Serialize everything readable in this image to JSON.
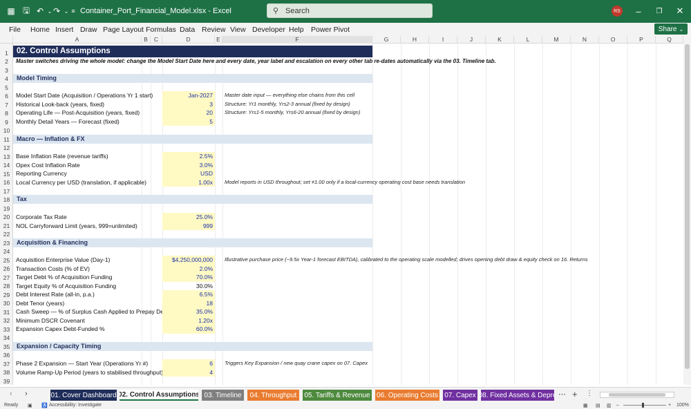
{
  "titlebar": {
    "filename": "Container_Port_Financial_Model.xlsx  -  Excel",
    "search_placeholder": "Search",
    "avatar": "RS"
  },
  "menu": [
    "File",
    "Home",
    "Insert",
    "Draw",
    "Page Layout",
    "Formulas",
    "Data",
    "Review",
    "View",
    "Developer",
    "Help",
    "Power Pivot"
  ],
  "share_label": "Share",
  "columns": [
    "A",
    "B",
    "C",
    "D",
    "E",
    "F",
    "G",
    "H",
    "I",
    "J",
    "K",
    "L",
    "M",
    "N",
    "O",
    "P",
    "Q"
  ],
  "rows": [
    "1",
    "2",
    "3",
    "4",
    "5",
    "6",
    "7",
    "8",
    "9",
    "10",
    "11",
    "12",
    "13",
    "14",
    "15",
    "16",
    "17",
    "18",
    "19",
    "20",
    "21",
    "22",
    "23",
    "24",
    "25",
    "26",
    "27",
    "28",
    "29",
    "30",
    "31",
    "32",
    "33",
    "34",
    "35",
    "36",
    "37",
    "38",
    "39"
  ],
  "sheet": {
    "title": "02. Control Assumptions",
    "subtitle": "Master switches driving the whole model: change the Model Start Date here and every date, year label and escalation on every other tab re-dates automatically via the 03. Timeline tab.",
    "sections": {
      "timing": "Model Timing",
      "macro": "Macro — Inflation & FX",
      "tax": "Tax",
      "acq": "Acquisition & Financing",
      "exp": "Expansion / Capacity Timing"
    },
    "items": {
      "r6": {
        "label": "Model Start Date (Acquisition / Operations Yr 1 start)",
        "value": "Jan-2027",
        "note": "Master date input — everything else chains from this cell"
      },
      "r7": {
        "label": "Historical Look-back (years, fixed)",
        "value": "3",
        "note": "Structure: Yr1 monthly, Yrs2-3 annual (fixed by design)"
      },
      "r8": {
        "label": "Operating Life — Post-Acquisition (years, fixed)",
        "value": "20",
        "note": "Structure: Yrs1-5 monthly, Yrs6-20 annual (fixed by design)"
      },
      "r9": {
        "label": "Monthly Detail Years — Forecast (fixed)",
        "value": "5"
      },
      "r13": {
        "label": "Base Inflation Rate (revenue tariffs)",
        "value": "2.5%"
      },
      "r14": {
        "label": "Opex Cost Inflation Rate",
        "value": "3.0%"
      },
      "r15": {
        "label": "Reporting Currency",
        "value": "USD"
      },
      "r16": {
        "label": "Local Currency per USD (translation, if applicable)",
        "value": "1.00x",
        "note": "Model reports in USD throughout; set ≠1.00 only if a local-currency operating cost base needs translation"
      },
      "r20": {
        "label": "Corporate Tax Rate",
        "value": "25.0%"
      },
      "r21": {
        "label": "NOL Carryforward Limit (years, 999=unlimited)",
        "value": "999"
      },
      "r25": {
        "label": "Acquisition Enterprise Value (Day-1)",
        "value": "$4,250,000,000",
        "note": "Illustrative purchase price (~9.5x Year-1 forecast EBITDA), calibrated to the operating scale modelled; drives opening debt draw & equity check on 16. Returns"
      },
      "r26": {
        "label": "Transaction Costs (% of EV)",
        "value": "2.0%"
      },
      "r27": {
        "label": "Target Debt % of Acquisition Funding",
        "value": "70.0%"
      },
      "r28": {
        "label": "Target Equity % of Acquisition Funding",
        "value": "30.0%"
      },
      "r29": {
        "label": "Debt Interest Rate (all-in, p.a.)",
        "value": "6.5%"
      },
      "r30": {
        "label": "Debt Tenor (years)",
        "value": "18"
      },
      "r31": {
        "label": "Cash Sweep — % of Surplus Cash Applied to Prepay Debt",
        "value": "35.0%"
      },
      "r32": {
        "label": "Minimum DSCR Covenant",
        "value": "1.20x"
      },
      "r33": {
        "label": "Expansion Capex Debt-Funded %",
        "value": "60.0%"
      },
      "r37": {
        "label": "Phase 2 Expansion — Start Year (Operations Yr #)",
        "value": "6",
        "note": "Triggers Key Expansion / new quay crane capex on 07. Capex"
      },
      "r38": {
        "label": "Volume Ramp-Up Period (years to stabilised throughput)",
        "value": "4"
      }
    }
  },
  "tabs": [
    {
      "label": "01. Cover Dashboard",
      "color": "#1f2d5a"
    },
    {
      "label": "02. Control Assumptions",
      "color": "#ffffff"
    },
    {
      "label": "03. Timeline",
      "color": "#7f7f7f"
    },
    {
      "label": "04. Throughput",
      "color": "#e97c30"
    },
    {
      "label": "05. Tariffs & Revenue",
      "color": "#4e8a3e"
    },
    {
      "label": "06. Operating Costs",
      "color": "#e97c30"
    },
    {
      "label": "07. Capex",
      "color": "#7030a0"
    },
    {
      "label": "08. Fixed Assets & Depre",
      "color": "#7030a0"
    }
  ],
  "status": {
    "ready": "Ready",
    "accessibility": "Accessibility: Investigate",
    "zoom": "100%"
  }
}
